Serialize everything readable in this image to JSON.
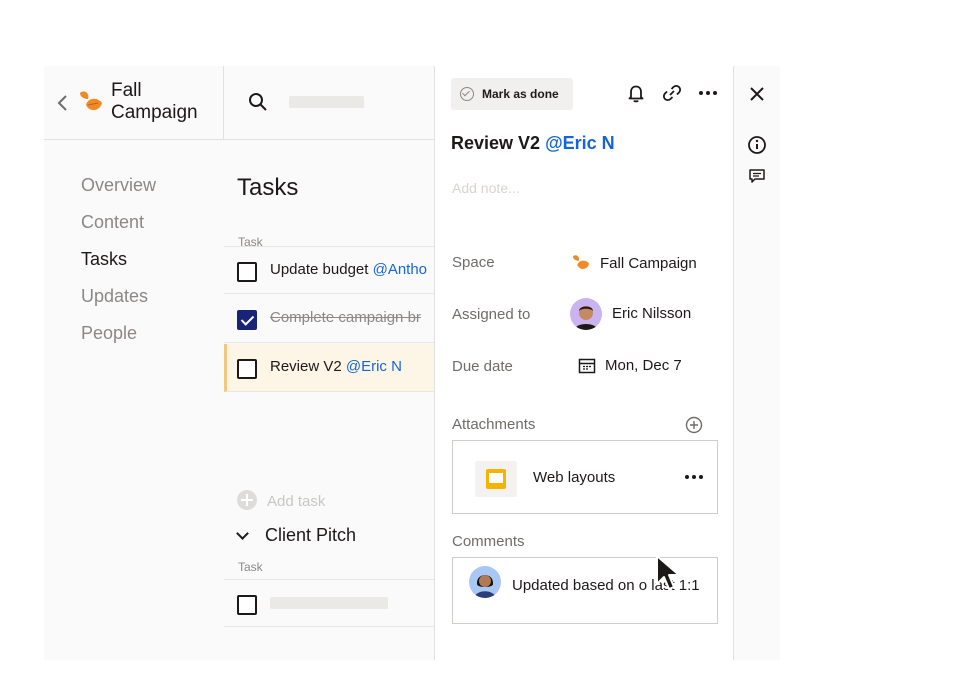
{
  "project": {
    "title": "Fall Campaign",
    "icon": "leaf-icon"
  },
  "search": {
    "icon": "search-icon"
  },
  "nav": {
    "items": [
      {
        "label": "Overview",
        "active": false
      },
      {
        "label": "Content",
        "active": false
      },
      {
        "label": "Tasks",
        "active": true
      },
      {
        "label": "Updates",
        "active": false
      },
      {
        "label": "People",
        "active": false
      }
    ]
  },
  "tasks": {
    "title": "Tasks",
    "column_label": "Task",
    "items": [
      {
        "text": "Update budget ",
        "mention": "@Antho",
        "done": false
      },
      {
        "text": "Complete campaign br",
        "mention": "",
        "done": true
      },
      {
        "text": "Review V2 ",
        "mention": "@Eric N",
        "done": false,
        "selected": true
      }
    ],
    "add_label": "Add task",
    "section": {
      "title": "Client Pitch",
      "column_label": "Task"
    }
  },
  "detail": {
    "mark_done": "Mark as done",
    "title": "Review V2 ",
    "title_mention": "@Eric N",
    "note_placeholder": "Add note...",
    "space_label": "Space",
    "space_value": "Fall Campaign",
    "assigned_label": "Assigned to",
    "assigned_value": "Eric Nilsson",
    "due_label": "Due date",
    "due_value": "Mon, Dec 7",
    "attachments_label": "Attachments",
    "attachment_name": "Web layouts",
    "comments_label": "Comments",
    "comment_text": "Updated based on o last 1:1"
  },
  "colors": {
    "mention": "#1565d8",
    "checkbox_checked": "#1a2475",
    "selected_row": "#fdf6e6",
    "accent_orange": "#f08a24"
  }
}
